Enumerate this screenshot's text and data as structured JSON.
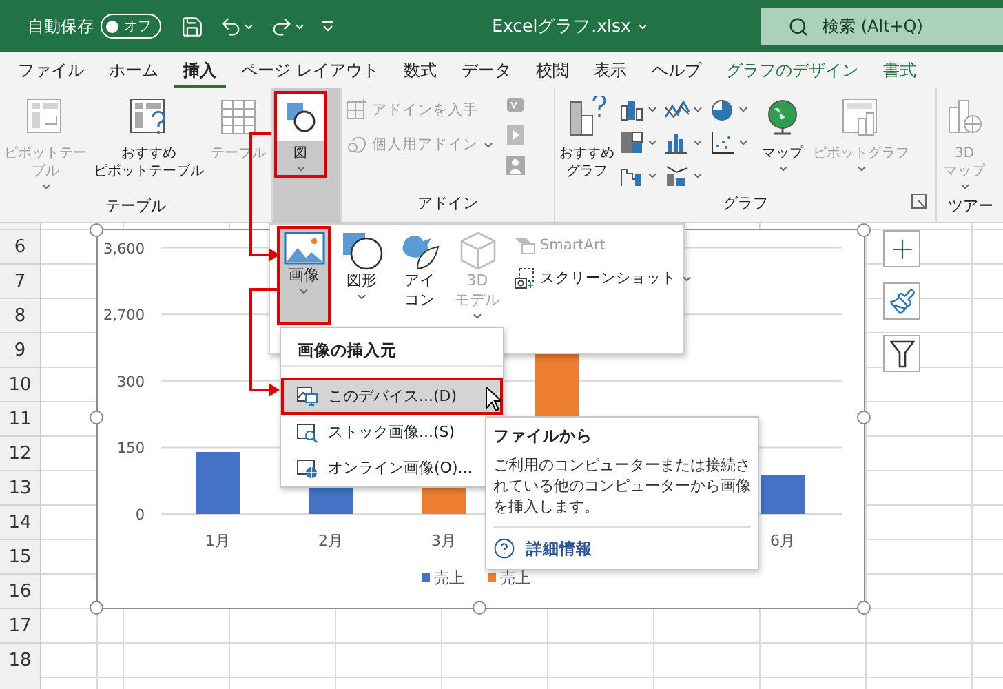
{
  "title_bar": {
    "autosave_label": "自動保存",
    "autosave": {
      "label": "オフ",
      "on": false
    },
    "file_name": "Excelグラフ.xlsx",
    "search": {
      "placeholder": "検索 (Alt+Q)"
    }
  },
  "tabs": [
    {
      "label": "ファイル",
      "selected": false,
      "kind": "normal"
    },
    {
      "label": "ホーム",
      "selected": false,
      "kind": "normal"
    },
    {
      "label": "挿入",
      "selected": true,
      "kind": "normal"
    },
    {
      "label": "ページ レイアウト",
      "selected": false,
      "kind": "normal"
    },
    {
      "label": "数式",
      "selected": false,
      "kind": "normal"
    },
    {
      "label": "データ",
      "selected": false,
      "kind": "normal"
    },
    {
      "label": "校閲",
      "selected": false,
      "kind": "normal"
    },
    {
      "label": "表示",
      "selected": false,
      "kind": "normal"
    },
    {
      "label": "ヘルプ",
      "selected": false,
      "kind": "normal"
    },
    {
      "label": "グラフのデザイン",
      "selected": false,
      "kind": "contextual"
    },
    {
      "label": "書式",
      "selected": false,
      "kind": "contextual"
    }
  ],
  "ribbon": {
    "groups": [
      {
        "kind": "tables",
        "label": "テーブル",
        "buttons": [
          {
            "lines": [
              "ピボットテー",
              "ブル"
            ],
            "disabled": true,
            "dropdown": true
          },
          {
            "lines": [
              "おすすめ",
              "ピボットテーブル"
            ],
            "disabled": false,
            "dropdown": false
          },
          {
            "lines": [
              "テーブル"
            ],
            "disabled": true,
            "dropdown": false
          }
        ]
      },
      {
        "kind": "illustrations",
        "buttons": [
          {
            "lines": [
              "図"
            ],
            "disabled": false,
            "dropdown": true,
            "pressed": true
          }
        ]
      },
      {
        "kind": "addins",
        "label": "アドイン",
        "buttons": [
          {
            "lines": [
              "アドインを入手"
            ],
            "disabled": true,
            "dropdown": false
          },
          {
            "lines": [
              "個人用アドイン"
            ],
            "disabled": true,
            "dropdown": true
          }
        ]
      },
      {
        "kind": "charts",
        "label": "グラフ",
        "buttons": [
          {
            "lines": [
              "おすすめ",
              "グラフ"
            ],
            "disabled": false,
            "dropdown": false
          },
          {
            "lines": [
              "マップ"
            ],
            "disabled": false,
            "dropdown": true
          },
          {
            "lines": [
              "ピボットグラフ"
            ],
            "disabled": true,
            "dropdown": true
          }
        ]
      },
      {
        "kind": "tours",
        "label": "ツアー",
        "buttons": [
          {
            "lines": [
              "3D",
              "マップ"
            ],
            "disabled": true,
            "dropdown": true
          }
        ]
      }
    ]
  },
  "gallery": {
    "buttons": [
      {
        "lines": [
          "画像"
        ],
        "kind": "large",
        "disabled": false,
        "dropdown": true,
        "pressed": true
      },
      {
        "lines": [
          "図形"
        ],
        "kind": "large",
        "disabled": false,
        "dropdown": true,
        "pressed": false
      },
      {
        "lines": [
          "アイ",
          "コン"
        ],
        "kind": "large",
        "disabled": false,
        "dropdown": false,
        "pressed": false
      },
      {
        "lines": [
          "3D",
          "モデル"
        ],
        "kind": "large",
        "disabled": true,
        "dropdown": true,
        "pressed": false
      },
      {
        "lines": [
          "SmartArt"
        ],
        "kind": "small",
        "disabled": true,
        "dropdown": false,
        "pressed": false
      },
      {
        "lines": [
          "スクリーンショット"
        ],
        "kind": "small",
        "disabled": false,
        "dropdown": true,
        "pressed": false
      }
    ]
  },
  "insert_menu": {
    "header": "画像の挿入元",
    "items": [
      {
        "label": "このデバイス...(D)",
        "selected": true
      },
      {
        "label": "ストック画像...(S)",
        "selected": false
      },
      {
        "label": "オンライン画像(O)...",
        "selected": false
      }
    ]
  },
  "tooltip": {
    "title": "ファイルから",
    "body": "ご利用のコンピューターまたは接続されている他のコンピューターから画像を挿入します。",
    "link": "詳細情報"
  },
  "sheet": {
    "rows": [
      "6",
      "7",
      "8",
      "9",
      "10",
      "11",
      "12",
      "13",
      "14",
      "15",
      "16",
      "17",
      "18"
    ]
  },
  "chart": {
    "y_axis_labels": [
      "3,600",
      "2,700",
      "300",
      "150",
      "0"
    ],
    "x_axis_labels": [
      "1月",
      "2月",
      "3月"
    ],
    "x_axis_labels_right": [
      "6月"
    ],
    "legend": [
      {
        "name": "売上",
        "color": "#4472c4"
      },
      {
        "name": "売上",
        "color": "#ed7d31"
      }
    ]
  }
}
